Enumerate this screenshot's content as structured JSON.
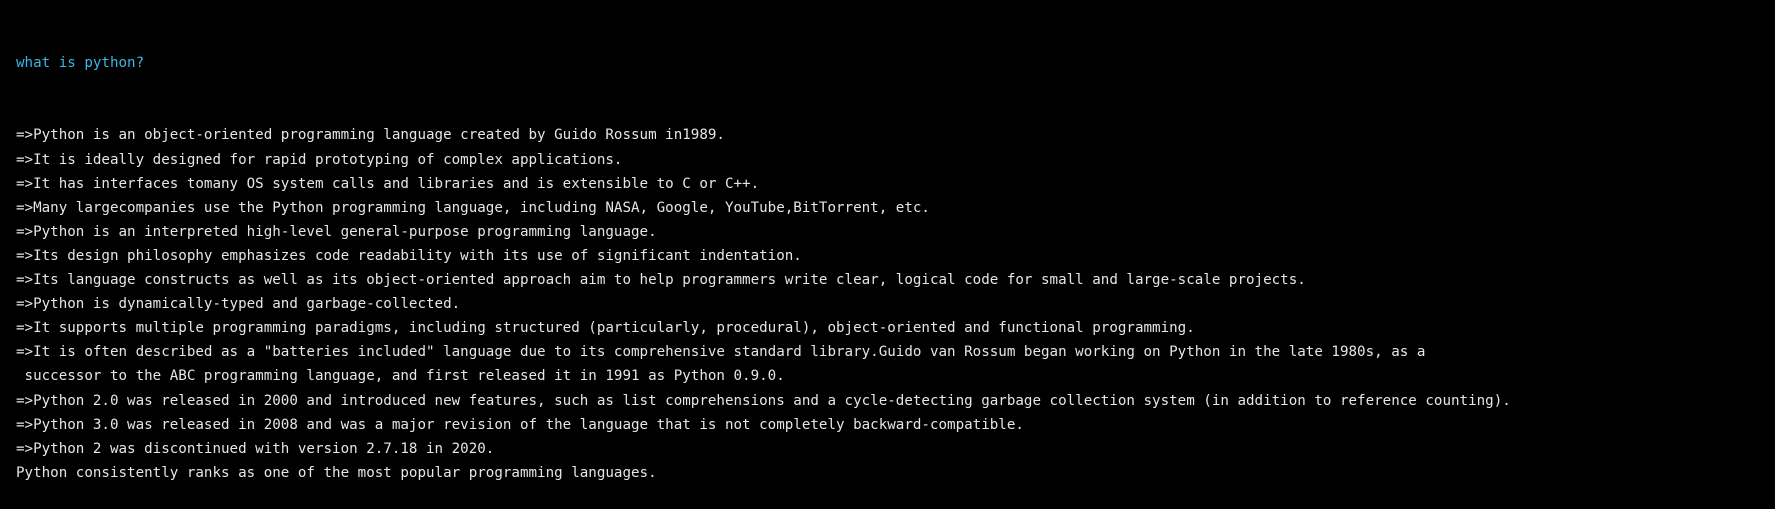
{
  "console": {
    "input_line": "what is python?",
    "input_color": "#3cb6e8",
    "text_color": "#e6e6e6",
    "background": "#000000",
    "output_lines": [
      "=>Python is an object-oriented programming language created by Guido Rossum in1989.",
      "=>It is ideally designed for rapid prototyping of complex applications.",
      "=>It has interfaces tomany OS system calls and libraries and is extensible to C or C++.",
      "=>Many largecompanies use the Python programming language, including NASA, Google, YouTube,BitTorrent, etc.",
      "=>Python is an interpreted high-level general-purpose programming language.",
      "=>Its design philosophy emphasizes code readability with its use of significant indentation.",
      "=>Its language constructs as well as its object-oriented approach aim to help programmers write clear, logical code for small and large-scale projects.",
      "=>Python is dynamically-typed and garbage-collected.",
      "=>It supports multiple programming paradigms, including structured (particularly, procedural), object-oriented and functional programming.",
      "=>It is often described as a \"batteries included\" language due to its comprehensive standard library.Guido van Rossum began working on Python in the late 1980s, as a",
      " successor to the ABC programming language, and first released it in 1991 as Python 0.9.0.",
      "=>Python 2.0 was released in 2000 and introduced new features, such as list comprehensions and a cycle-detecting garbage collection system (in addition to reference counting).",
      "=>Python 3.0 was released in 2008 and was a major revision of the language that is not completely backward-compatible.",
      "=>Python 2 was discontinued with version 2.7.18 in 2020.",
      "Python consistently ranks as one of the most popular programming languages."
    ]
  }
}
